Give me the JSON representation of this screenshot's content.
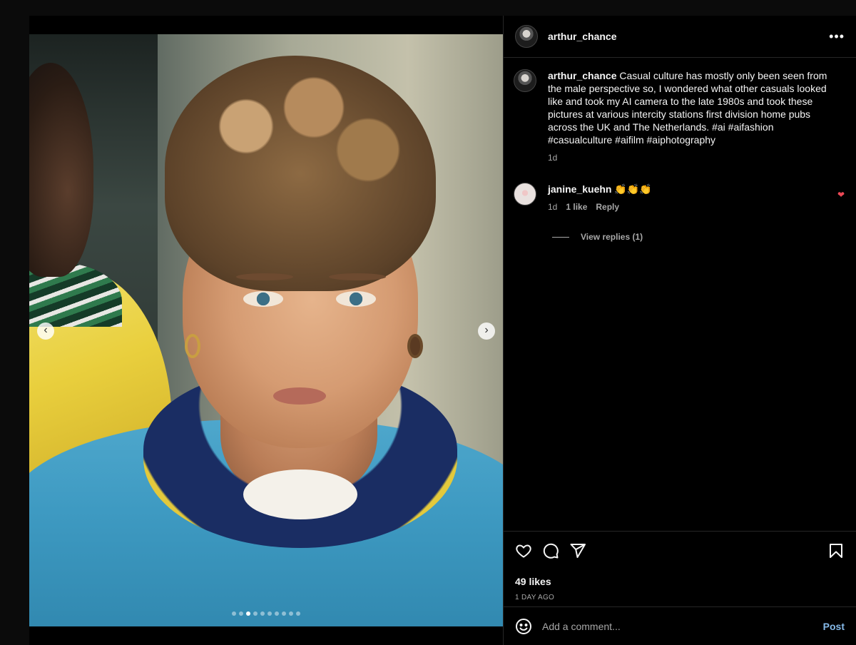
{
  "post": {
    "author": "arthur_chance",
    "more_icon": "more-horizontal-icon"
  },
  "caption": {
    "user": "arthur_chance",
    "text": " Casual culture has mostly only been seen from the male perspective so, I wondered what other casuals looked like and took my AI camera to the late 1980s and took these pictures at various intercity stations first division home pubs across the UK and The Netherlands. #ai #aifashion #casualculture #aifilm #aiphotography",
    "time": "1d"
  },
  "comments": [
    {
      "user": "janine_kuehn",
      "text": " 👏👏👏",
      "time": "1d",
      "likes": "1 like",
      "reply": "Reply",
      "liked": true,
      "view_replies": "View replies (1)"
    }
  ],
  "carousel": {
    "slide_count": 10,
    "active_index": 2
  },
  "stats": {
    "likes": "49 likes",
    "date": "1 DAY AGO"
  },
  "composer": {
    "placeholder": "Add a comment...",
    "post_label": "Post"
  },
  "colors": {
    "accent": "#85b9e8",
    "like": "#ed4956",
    "background": "#000000"
  }
}
